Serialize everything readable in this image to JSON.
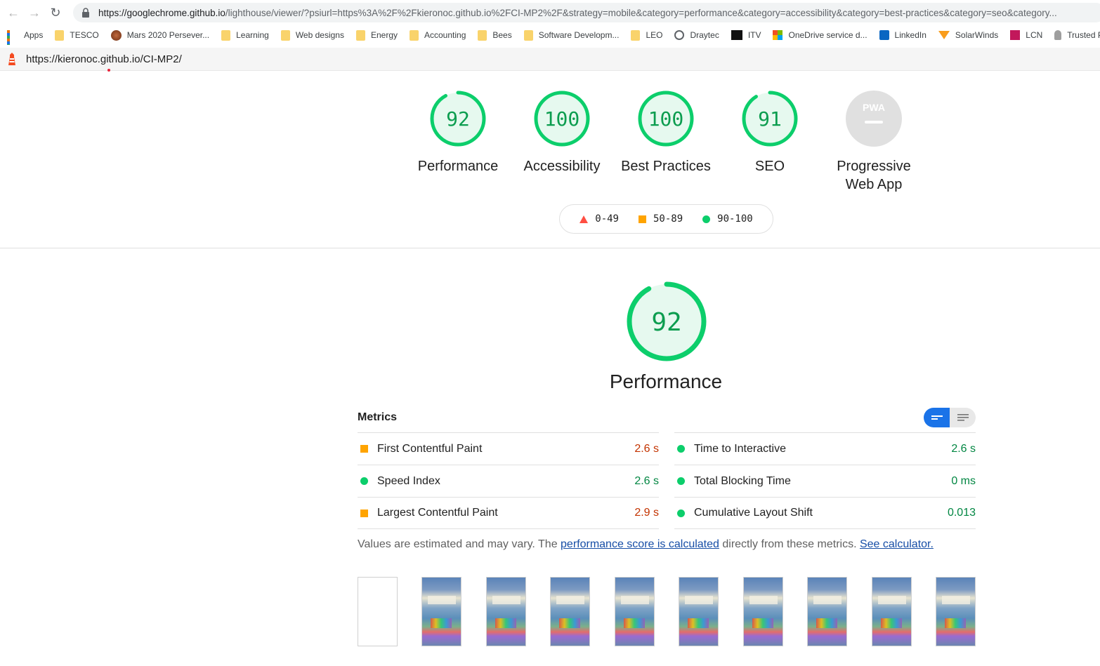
{
  "browser": {
    "url_host": "https://googlechrome.github.io",
    "url_rest": "/lighthouse/viewer/?psiurl=https%3A%2F%2Fkieronoc.github.io%2FCI-MP2%2F&strategy=mobile&category=performance&category=accessibility&category=best-practices&category=seo&category..."
  },
  "bookmarks": [
    {
      "label": "Apps",
      "icon": "apps-icon"
    },
    {
      "label": "TESCO",
      "icon": "folder-icon"
    },
    {
      "label": "Mars 2020 Persever...",
      "icon": "mars-icon"
    },
    {
      "label": "Learning",
      "icon": "folder-icon"
    },
    {
      "label": "Web designs",
      "icon": "folder-icon"
    },
    {
      "label": "Energy",
      "icon": "folder-icon"
    },
    {
      "label": "Accounting",
      "icon": "folder-icon"
    },
    {
      "label": "Bees",
      "icon": "folder-icon"
    },
    {
      "label": "Software Developm...",
      "icon": "folder-icon"
    },
    {
      "label": "LEO",
      "icon": "folder-icon"
    },
    {
      "label": "Draytec",
      "icon": "globe-icon"
    },
    {
      "label": "ITV",
      "icon": "itv-icon"
    },
    {
      "label": "OneDrive service d...",
      "icon": "microsoft-icon"
    },
    {
      "label": "LinkedIn",
      "icon": "linkedin-icon"
    },
    {
      "label": "SolarWinds",
      "icon": "solarwinds-icon"
    },
    {
      "label": "LCN",
      "icon": "lcn-icon"
    },
    {
      "label": "Trusted PC",
      "icon": "person-icon"
    }
  ],
  "report": {
    "tested_url": "https://kieronoc.github.io/CI-MP2/"
  },
  "scores": [
    {
      "label": "Performance",
      "value": "92",
      "score": 0.92
    },
    {
      "label": "Accessibility",
      "value": "100",
      "score": 1.0
    },
    {
      "label": "Best Practices",
      "value": "100",
      "score": 1.0
    },
    {
      "label": "SEO",
      "value": "91",
      "score": 0.91
    }
  ],
  "pwa": {
    "label_line1": "Progressive",
    "label_line2": "Web App",
    "badge": "PWA"
  },
  "legend": [
    {
      "range": "0-49",
      "shape": "triangle",
      "color": "#ff4e42"
    },
    {
      "range": "50-89",
      "shape": "square",
      "color": "#ffa400"
    },
    {
      "range": "90-100",
      "shape": "circle",
      "color": "#0cce6b"
    }
  ],
  "performance": {
    "value": "92",
    "score": 0.92,
    "label": "Performance"
  },
  "metrics": {
    "title": "Metrics",
    "left": [
      {
        "name": "First Contentful Paint",
        "value": "2.6 s",
        "rating": "average"
      },
      {
        "name": "Speed Index",
        "value": "2.6 s",
        "rating": "pass"
      },
      {
        "name": "Largest Contentful Paint",
        "value": "2.9 s",
        "rating": "average"
      }
    ],
    "right": [
      {
        "name": "Time to Interactive",
        "value": "2.6 s",
        "rating": "pass"
      },
      {
        "name": "Total Blocking Time",
        "value": "0 ms",
        "rating": "pass"
      },
      {
        "name": "Cumulative Layout Shift",
        "value": "0.013",
        "rating": "pass"
      }
    ]
  },
  "note": {
    "prefix": "Values are estimated and may vary. The ",
    "link1": "performance score is calculated",
    "middle": " directly from these metrics. ",
    "link2": "See calculator."
  },
  "colors": {
    "pass": "#0cce6b",
    "pass_text": "#018642",
    "average": "#ffa400",
    "fail": "#ff4e42",
    "accent": "#1a73e8"
  }
}
